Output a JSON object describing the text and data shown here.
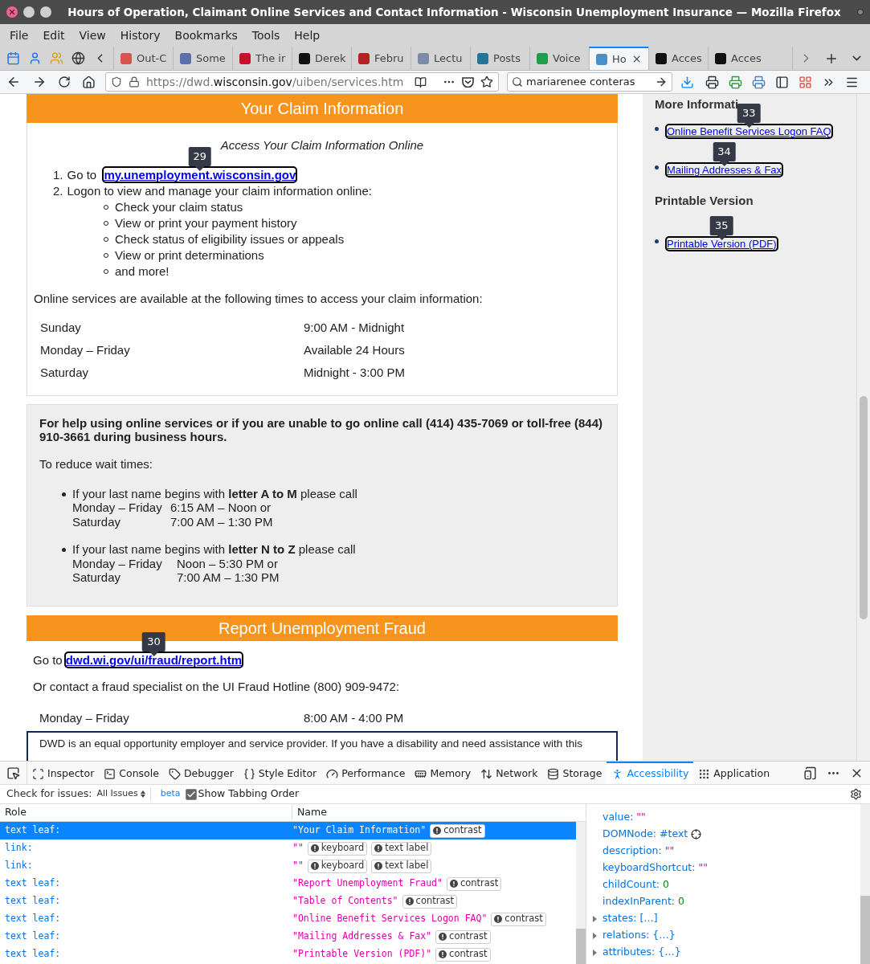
{
  "window": {
    "title": "Hours of Operation, Claimant Online Services and Contact Information - Wisconsin Unemployment Insurance — Mozilla Firefox"
  },
  "menu": [
    "File",
    "Edit",
    "View",
    "History",
    "Bookmarks",
    "Tools",
    "Help"
  ],
  "tabs": [
    {
      "label": "Out-C",
      "selected": false,
      "color": "#d9534f"
    },
    {
      "label": "Some",
      "selected": false,
      "color": "#5b6fa8"
    },
    {
      "label": "The ir",
      "selected": false,
      "color": "#c8102e"
    },
    {
      "label": "Derek",
      "selected": false,
      "color": "#111111"
    },
    {
      "label": "Febru",
      "selected": false,
      "color": "#b22222"
    },
    {
      "label": "Lectu",
      "selected": false,
      "color": "#7a8ca8"
    },
    {
      "label": "Posts",
      "selected": false,
      "color": "#21759b"
    },
    {
      "label": "Voice",
      "selected": false,
      "color": "#1e9e4a"
    },
    {
      "label": "Ho",
      "selected": true,
      "color": "#4a90c8"
    },
    {
      "label": "Acces",
      "selected": false,
      "color": "#111111"
    },
    {
      "label": "Acces",
      "selected": false,
      "color": "#111111"
    }
  ],
  "address": {
    "scheme": "https://dwd.",
    "domain": "wisconsin.gov",
    "path": "/uiben/services.htm"
  },
  "search": {
    "value": "mariarenee conteras"
  },
  "claim": {
    "title": "Your Claim Information",
    "subtitle": "Access Your Claim Information Online",
    "steps": [
      {
        "number": "1.",
        "text": "Go to ",
        "link": {
          "text": "my.unemployment.wisconsin.gov",
          "tab_order": "29"
        }
      },
      {
        "number": "2.",
        "text": "Logon to view and manage your claim information online:",
        "items": [
          "Check your claim status",
          "View or print your payment history",
          "Check status of eligibility issues or appeals",
          "View or print determinations",
          "and more!"
        ]
      }
    ],
    "intro": "Online services are available at the following times to access your claim information:",
    "hours": [
      {
        "day": "Sunday",
        "time": "9:00 AM - Midnight"
      },
      {
        "day": "Monday – Friday",
        "time": "Available 24 Hours"
      },
      {
        "day": "Saturday",
        "time": "Midnight - 3:00 PM"
      }
    ]
  },
  "help": {
    "lead": "For help using online services or if you are unable to go online call (414) 435-7069 or toll-free (844) 910-3661 during business hours.",
    "reduce": "To reduce wait times:",
    "groups": [
      {
        "text": "If your last name begins with **letter A to M** please call",
        "lines": [
          {
            "days": "Monday – Friday",
            "time": "6:15 AM – Noon or"
          },
          {
            "days": "Saturday",
            "time": "7:00 AM – 1:30 PM"
          }
        ]
      },
      {
        "text": "If your last name begins with **letter N to Z** please call",
        "lines": [
          {
            "days": "Monday – Friday",
            "time": "Noon – 5:30 PM or"
          },
          {
            "days": "Saturday",
            "time": "7:00 AM – 1:30 PM"
          }
        ]
      }
    ]
  },
  "fraud": {
    "title": "Report Unemployment Fraud",
    "goto": "Go to ",
    "link": {
      "text": "dwd.wi.gov/ui/fraud/report.htm",
      "tab_order": "30"
    },
    "contact": "Or contact a fraud specialist on the UI Fraud Hotline (800) 909-9472:",
    "hours": [
      {
        "day": "Monday – Friday",
        "time": "8:00 AM - 4:00 PM"
      }
    ]
  },
  "notice": "DWD is an equal opportunity employer and service provider. If you have a disability and need assistance with this",
  "sidebar": [
    {
      "heading": "More Informati",
      "links": [
        {
          "text": "Online Benefit Services Logon FAQ",
          "tab_order": "33"
        },
        {
          "text": "Mailing Addresses & Fax",
          "tab_order": "34"
        }
      ]
    },
    {
      "heading": "Printable Version",
      "links": [
        {
          "text": "Printable Version (PDF)",
          "tab_order": "35"
        }
      ]
    }
  ],
  "devtools": {
    "tools": [
      {
        "label": "Inspector",
        "selected": false
      },
      {
        "label": "Console",
        "selected": false
      },
      {
        "label": "Debugger",
        "selected": false
      },
      {
        "label": "Style Editor",
        "selected": false
      },
      {
        "label": "Performance",
        "selected": false
      },
      {
        "label": "Memory",
        "selected": false
      },
      {
        "label": "Network",
        "selected": false
      },
      {
        "label": "Storage",
        "selected": false
      },
      {
        "label": "Accessibility",
        "selected": true
      },
      {
        "label": "Application",
        "selected": false
      }
    ],
    "filter": {
      "label": "Check for issues:",
      "value": "All Issues",
      "beta": "beta",
      "tabbing_label": "Show Tabbing Order",
      "tabbing_checked": true
    },
    "columns": [
      "Role",
      "Name"
    ],
    "rows": [
      {
        "role": "text leaf:",
        "name": "\"Your Claim Information\"",
        "badges": [
          "contrast"
        ],
        "selected": true
      },
      {
        "role": "link:",
        "name": "\"\"",
        "badges": [
          "keyboard",
          "text label"
        ],
        "selected": false
      },
      {
        "role": "link:",
        "name": "\"\"",
        "badges": [
          "keyboard",
          "text label"
        ],
        "selected": false
      },
      {
        "role": "text leaf:",
        "name": "\"Report Unemployment Fraud\"",
        "badges": [
          "contrast"
        ],
        "selected": false
      },
      {
        "role": "text leaf:",
        "name": "\"Table of Contents\"",
        "badges": [
          "contrast"
        ],
        "selected": false
      },
      {
        "role": "text leaf:",
        "name": "\"Online Benefit Services Logon FAQ\"",
        "badges": [
          "contrast"
        ],
        "selected": false
      },
      {
        "role": "text leaf:",
        "name": "\"Mailing Addresses & Fax\"",
        "badges": [
          "contrast"
        ],
        "selected": false
      },
      {
        "role": "text leaf:",
        "name": "\"Printable Version (PDF)\"",
        "badges": [
          "contrast"
        ],
        "selected": false
      }
    ],
    "properties": [
      {
        "key": "value:",
        "value": "\"\"",
        "kind": "string"
      },
      {
        "key": "DOMNode:",
        "value": "#text",
        "kind": "node"
      },
      {
        "key": "description:",
        "value": "\"\"",
        "kind": "string"
      },
      {
        "key": "keyboardShortcut:",
        "value": "\"\"",
        "kind": "string"
      },
      {
        "key": "childCount:",
        "value": "0",
        "kind": "number"
      },
      {
        "key": "indexInParent:",
        "value": "0",
        "kind": "number"
      },
      {
        "key": "states:",
        "value": "[…]",
        "kind": "group"
      },
      {
        "key": "relations:",
        "value": "{…}",
        "kind": "group"
      },
      {
        "key": "attributes:",
        "value": "{…}",
        "kind": "group"
      }
    ]
  }
}
